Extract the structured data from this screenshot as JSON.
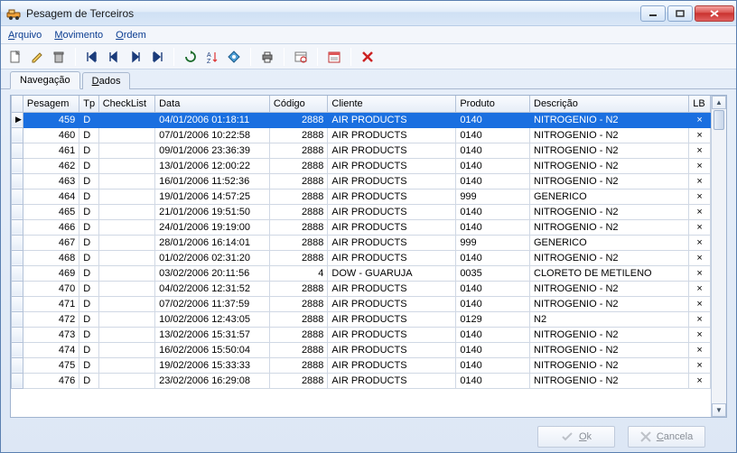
{
  "window": {
    "title": "Pesagem de Terceiros"
  },
  "menu": {
    "arquivo": "Arquivo",
    "movimento": "Movimento",
    "ordem": "Ordem"
  },
  "tabs": {
    "navegacao": "Navegação",
    "dados": "Dados"
  },
  "columns": {
    "pesagem": "Pesagem",
    "tp": "Tp",
    "checklist": "CheckList",
    "data": "Data",
    "codigo": "Código",
    "cliente": "Cliente",
    "produto": "Produto",
    "descricao": "Descrição",
    "lb": "LB"
  },
  "rows": [
    {
      "pesagem": "459",
      "tp": "D",
      "checklist": "",
      "data": "04/01/2006 01:18:11",
      "codigo": "2888",
      "cliente": "AIR PRODUCTS",
      "produto": "0140",
      "descricao": "NITROGENIO - N2",
      "lb": "×",
      "selected": true
    },
    {
      "pesagem": "460",
      "tp": "D",
      "checklist": "",
      "data": "07/01/2006 10:22:58",
      "codigo": "2888",
      "cliente": "AIR PRODUCTS",
      "produto": "0140",
      "descricao": "NITROGENIO - N2",
      "lb": "×"
    },
    {
      "pesagem": "461",
      "tp": "D",
      "checklist": "",
      "data": "09/01/2006 23:36:39",
      "codigo": "2888",
      "cliente": "AIR PRODUCTS",
      "produto": "0140",
      "descricao": "NITROGENIO - N2",
      "lb": "×"
    },
    {
      "pesagem": "462",
      "tp": "D",
      "checklist": "",
      "data": "13/01/2006 12:00:22",
      "codigo": "2888",
      "cliente": "AIR PRODUCTS",
      "produto": "0140",
      "descricao": "NITROGENIO - N2",
      "lb": "×"
    },
    {
      "pesagem": "463",
      "tp": "D",
      "checklist": "",
      "data": "16/01/2006 11:52:36",
      "codigo": "2888",
      "cliente": "AIR PRODUCTS",
      "produto": "0140",
      "descricao": "NITROGENIO - N2",
      "lb": "×"
    },
    {
      "pesagem": "464",
      "tp": "D",
      "checklist": "",
      "data": "19/01/2006 14:57:25",
      "codigo": "2888",
      "cliente": "AIR PRODUCTS",
      "produto": "999",
      "descricao": "GENERICO",
      "lb": "×"
    },
    {
      "pesagem": "465",
      "tp": "D",
      "checklist": "",
      "data": "21/01/2006 19:51:50",
      "codigo": "2888",
      "cliente": "AIR PRODUCTS",
      "produto": "0140",
      "descricao": "NITROGENIO - N2",
      "lb": "×"
    },
    {
      "pesagem": "466",
      "tp": "D",
      "checklist": "",
      "data": "24/01/2006 19:19:00",
      "codigo": "2888",
      "cliente": "AIR PRODUCTS",
      "produto": "0140",
      "descricao": "NITROGENIO - N2",
      "lb": "×"
    },
    {
      "pesagem": "467",
      "tp": "D",
      "checklist": "",
      "data": "28/01/2006 16:14:01",
      "codigo": "2888",
      "cliente": "AIR PRODUCTS",
      "produto": "999",
      "descricao": "GENERICO",
      "lb": "×"
    },
    {
      "pesagem": "468",
      "tp": "D",
      "checklist": "",
      "data": "01/02/2006 02:31:20",
      "codigo": "2888",
      "cliente": "AIR PRODUCTS",
      "produto": "0140",
      "descricao": "NITROGENIO - N2",
      "lb": "×"
    },
    {
      "pesagem": "469",
      "tp": "D",
      "checklist": "",
      "data": "03/02/2006 20:11:56",
      "codigo": "4",
      "cliente": "DOW - GUARUJA",
      "produto": "0035",
      "descricao": "CLORETO DE METILENO",
      "lb": "×"
    },
    {
      "pesagem": "470",
      "tp": "D",
      "checklist": "",
      "data": "04/02/2006 12:31:52",
      "codigo": "2888",
      "cliente": "AIR PRODUCTS",
      "produto": "0140",
      "descricao": "NITROGENIO - N2",
      "lb": "×"
    },
    {
      "pesagem": "471",
      "tp": "D",
      "checklist": "",
      "data": "07/02/2006 11:37:59",
      "codigo": "2888",
      "cliente": "AIR PRODUCTS",
      "produto": "0140",
      "descricao": "NITROGENIO - N2",
      "lb": "×"
    },
    {
      "pesagem": "472",
      "tp": "D",
      "checklist": "",
      "data": "10/02/2006 12:43:05",
      "codigo": "2888",
      "cliente": "AIR PRODUCTS",
      "produto": "0129",
      "descricao": "N2",
      "lb": "×"
    },
    {
      "pesagem": "473",
      "tp": "D",
      "checklist": "",
      "data": "13/02/2006 15:31:57",
      "codigo": "2888",
      "cliente": "AIR PRODUCTS",
      "produto": "0140",
      "descricao": "NITROGENIO - N2",
      "lb": "×"
    },
    {
      "pesagem": "474",
      "tp": "D",
      "checklist": "",
      "data": "16/02/2006 15:50:04",
      "codigo": "2888",
      "cliente": "AIR PRODUCTS",
      "produto": "0140",
      "descricao": "NITROGENIO - N2",
      "lb": "×"
    },
    {
      "pesagem": "475",
      "tp": "D",
      "checklist": "",
      "data": "19/02/2006 15:33:33",
      "codigo": "2888",
      "cliente": "AIR PRODUCTS",
      "produto": "0140",
      "descricao": "NITROGENIO - N2",
      "lb": "×"
    },
    {
      "pesagem": "476",
      "tp": "D",
      "checklist": "",
      "data": "23/02/2006 16:29:08",
      "codigo": "2888",
      "cliente": "AIR PRODUCTS",
      "produto": "0140",
      "descricao": "NITROGENIO - N2",
      "lb": "×"
    }
  ],
  "buttons": {
    "ok": "Ok",
    "cancel": "Cancela"
  }
}
